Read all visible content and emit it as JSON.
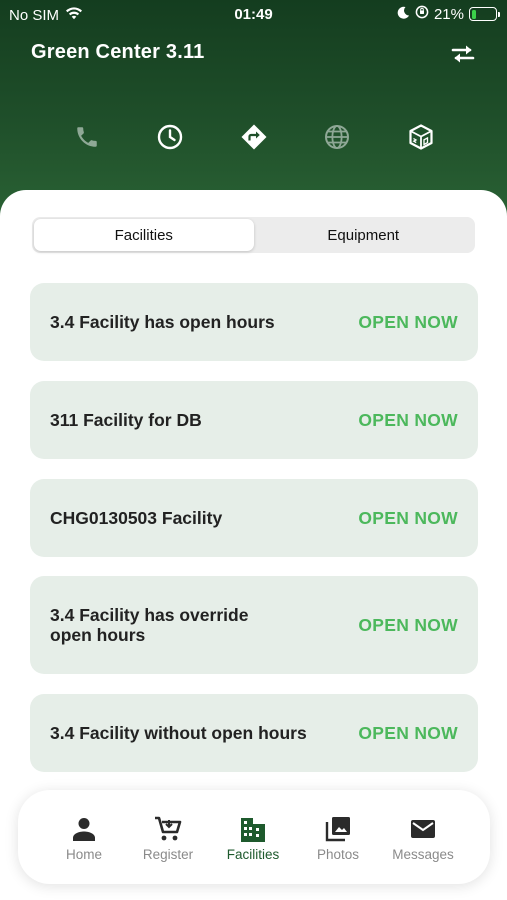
{
  "status_bar": {
    "carrier": "No SIM",
    "time": "01:49",
    "battery": "21%",
    "battery_level": 0.21
  },
  "header": {
    "title": "Green Center 3.11",
    "actions": [
      "phone-icon",
      "clock-icon",
      "directions-icon",
      "globe-icon",
      "cube-3d-icon"
    ]
  },
  "segmented": {
    "tabs": [
      {
        "label": "Facilities",
        "selected": true
      },
      {
        "label": "Equipment",
        "selected": false
      }
    ]
  },
  "facilities": [
    {
      "name": "3.4 Facility has open hours",
      "status": "OPEN NOW"
    },
    {
      "name": "311 Facility for DB",
      "status": "OPEN NOW"
    },
    {
      "name": "CHG0130503 Facility",
      "status": "OPEN NOW"
    },
    {
      "name": "3.4 Facility has override open hours",
      "status": "OPEN NOW"
    },
    {
      "name": "3.4 Facility without open hours",
      "status": "OPEN NOW"
    }
  ],
  "tabbar": {
    "items": [
      {
        "label": "Home",
        "icon": "person-icon",
        "active": false
      },
      {
        "label": "Register",
        "icon": "cart-icon",
        "active": false
      },
      {
        "label": "Facilities",
        "icon": "building-icon",
        "active": true
      },
      {
        "label": "Photos",
        "icon": "photos-icon",
        "active": false
      },
      {
        "label": "Messages",
        "icon": "mail-icon",
        "active": false
      }
    ]
  },
  "colors": {
    "header_dark": "#143d1f",
    "header_light": "#2a6234",
    "card_bg": "#e6eee8",
    "open_status": "#4cb85c",
    "tab_active": "#1e5a2d",
    "tab_inactive": "#8a8a8a"
  }
}
